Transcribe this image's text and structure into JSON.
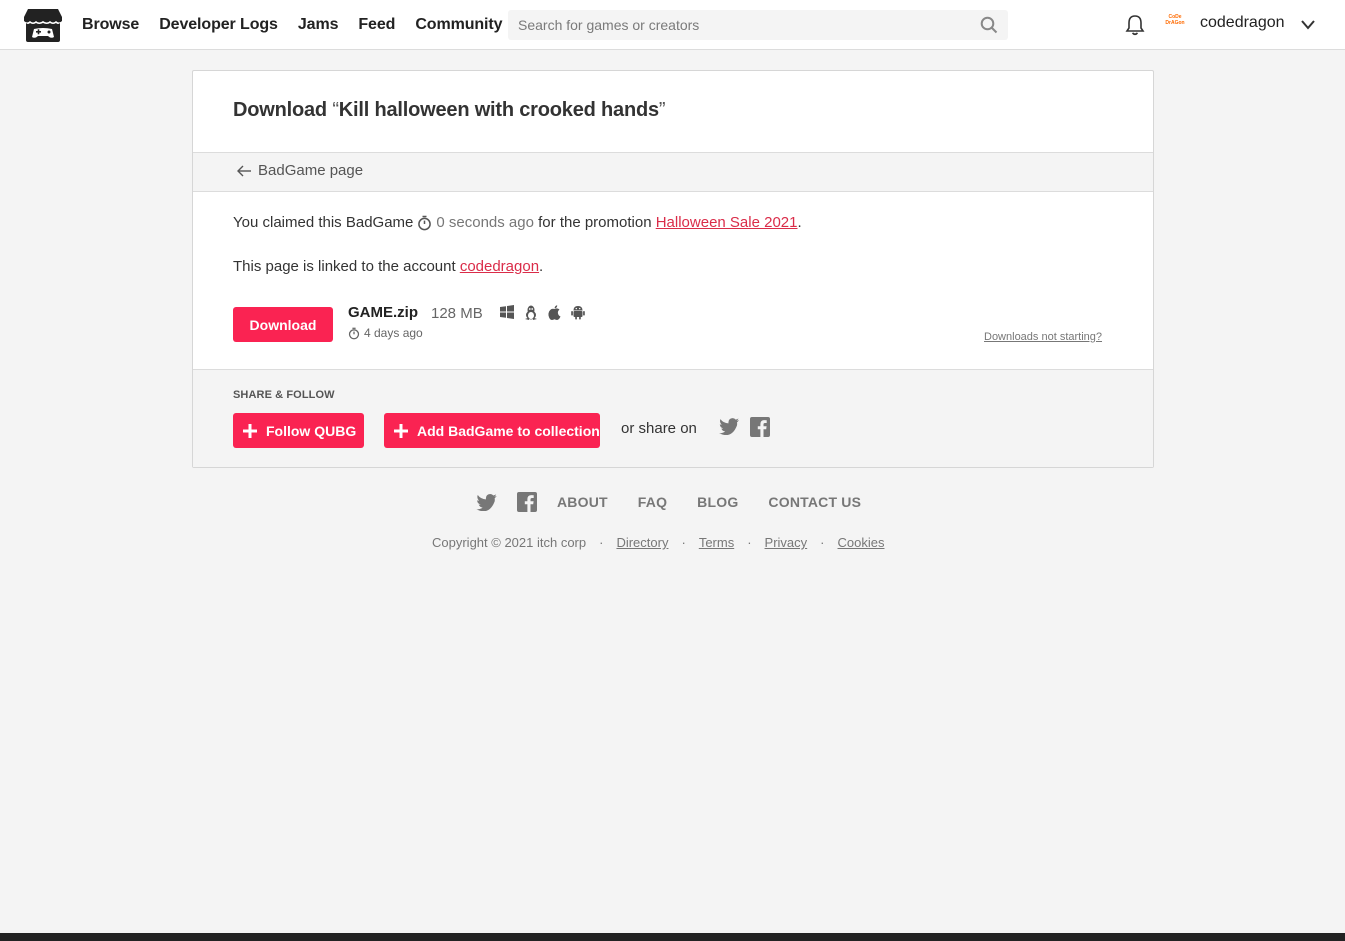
{
  "header": {
    "nav": [
      "Browse",
      "Developer Logs",
      "Jams",
      "Feed",
      "Community"
    ],
    "search_placeholder": "Search for games or creators",
    "avatar_text": "CoDe DrAGon",
    "username": "codedragon"
  },
  "card": {
    "title_prefix": "Download ",
    "open_quote": "“",
    "title": "Kill halloween with crooked hands",
    "close_quote": "”",
    "back_link": "BadGame page",
    "claim_prefix": "You claimed this BadGame",
    "claim_time": "0 seconds ago",
    "claim_mid": "for the promotion",
    "promotion": "Halloween Sale 2021",
    "period": ".",
    "linked_prefix": "This page is linked to the account ",
    "linked_account": "codedragon",
    "download_label": "Download",
    "file_name": "GAME.zip",
    "file_size": "128 MB",
    "file_date": "4 days ago",
    "platforms": [
      "windows-icon",
      "linux-icon",
      "apple-icon",
      "android-icon"
    ],
    "not_starting": "Downloads not starting?"
  },
  "share": {
    "heading": "SHARE & FOLLOW",
    "follow_label": "Follow QUBG",
    "collection_label": "Add BadGame to collection",
    "share_text": "or share on"
  },
  "footer": {
    "links": [
      "ABOUT",
      "FAQ",
      "BLOG",
      "CONTACT US"
    ],
    "copyright": "Copyright © 2021 itch corp",
    "sep": "·",
    "legal": [
      "Directory",
      "Terms",
      "Privacy",
      "Cookies"
    ]
  },
  "colors": {
    "accent": "#fa2352",
    "link": "#da2c49",
    "background": "#f4f4f4"
  }
}
